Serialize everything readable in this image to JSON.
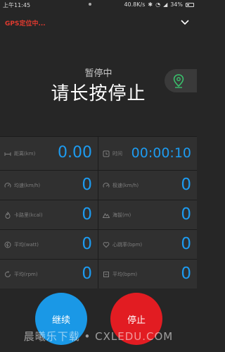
{
  "status_bar": {
    "time": "上午11:45",
    "speed": "40.8K/s",
    "battery": "34%"
  },
  "gps_status": "GPS定位中...",
  "state_label": "暂停中",
  "hint_label": "请长按停止",
  "metrics": [
    {
      "icon": "distance-icon",
      "label": "距离(km)",
      "value": "0.00"
    },
    {
      "icon": "clock-icon",
      "label": "时间",
      "value": "00:00:10"
    },
    {
      "icon": "speed-icon",
      "label": "均速(km/h)",
      "value": "0"
    },
    {
      "icon": "max-speed-icon",
      "label": "极速(km/h)",
      "value": "0"
    },
    {
      "icon": "calorie-icon",
      "label": "卡路里(kcal)",
      "value": "0"
    },
    {
      "icon": "altitude-icon",
      "label": "海拔(m)",
      "value": "0"
    },
    {
      "icon": "power-icon",
      "label": "平均(watt)",
      "value": "0"
    },
    {
      "icon": "heart-rate-icon",
      "label": "心跳率(bpm)",
      "value": "0"
    },
    {
      "icon": "cadence-icon",
      "label": "平均(rpm)",
      "value": "0"
    },
    {
      "icon": "cadence-bpm-icon",
      "label": "平均(bpm)",
      "value": "0"
    }
  ],
  "buttons": {
    "resume": "继续",
    "stop": "停止"
  },
  "watermark": "晨曦乐下载 • CXLEDU.COM",
  "colors": {
    "accent": "#1d9bf0",
    "stop": "#e21c22",
    "gps": "#e03a2f",
    "map_icon": "#39c16c"
  }
}
